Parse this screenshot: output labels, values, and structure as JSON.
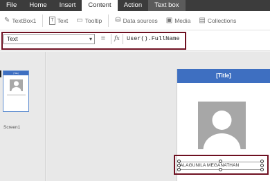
{
  "menu": {
    "tabs": [
      "File",
      "Home",
      "Insert",
      "Content",
      "Action",
      "Text box"
    ],
    "active": "Content"
  },
  "ribbon": {
    "control_name": "TextBox1",
    "text": "Text",
    "tooltip": "Tooltip",
    "data_sources": "Data sources",
    "media": "Media",
    "collections": "Collections",
    "icons": [
      "edit-icon",
      "text-icon",
      "tooltip-icon",
      "database-icon",
      "media-icon",
      "collections-icon"
    ]
  },
  "formula_bar": {
    "property": "Text",
    "equals": "=",
    "fx": "fx",
    "formula": "User().FullName"
  },
  "screens": {
    "thumbnail_label": "Screen1",
    "thumbnail_header": "[Title]"
  },
  "canvas": {
    "title": "[Title]",
    "name_value": "ALAGUNILA MEGANATHAN",
    "header_color": "#3e6fc1",
    "highlight_color": "#6e1021"
  }
}
